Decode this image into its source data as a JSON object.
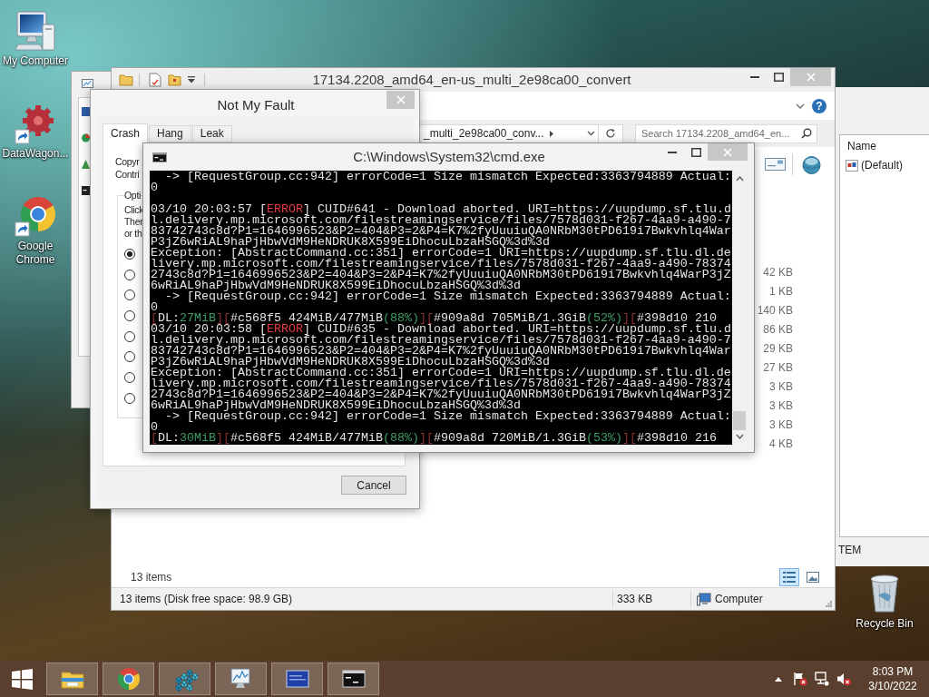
{
  "desktop_icons": [
    {
      "label": "My Computer",
      "kind": "computer",
      "shortcut": false
    },
    {
      "label": "DataWagon...",
      "kind": "gear",
      "shortcut": true
    },
    {
      "label": "Google Chrome",
      "kind": "browser",
      "shortcut": true
    }
  ],
  "recycle_bin": {
    "label": "Recycle Bin"
  },
  "registry_window": {
    "column": "Name",
    "values": [
      "(Default)"
    ],
    "status": "TEM"
  },
  "explorer": {
    "title": "17134.2208_amd64_en-us_multi_2e98ca00_convert",
    "help": "?",
    "address": "_multi_2e98ca00_conv...",
    "search": {
      "placeholder": "Search 17134.2208_amd64_en..."
    },
    "sizes": [
      "42 KB",
      "1 KB",
      "140 KB",
      "86 KB",
      "29 KB",
      "27 KB",
      "3 KB",
      "3 KB",
      "3 KB",
      "4 KB"
    ],
    "item_count": "13 items",
    "views": [
      {
        "kind": "details",
        "selected": true
      },
      {
        "kind": "thumbnails",
        "selected": false
      }
    ],
    "status_bar": {
      "summary": "13 items (Disk free space: 98.9 GB)",
      "size": "333 KB",
      "location": "Computer"
    }
  },
  "fault_dialog": {
    "title": "Not My Fault",
    "tabs": [
      {
        "label": "Crash",
        "selected": true
      },
      {
        "label": "Hang",
        "selected": false
      },
      {
        "label": "Leak",
        "selected": false
      }
    ],
    "info_lines": [
      "Copyr",
      "Contri"
    ],
    "group_label": "Opti",
    "description_lines": [
      "Click",
      "Ther",
      "or th"
    ],
    "options": [
      {
        "selected": true
      },
      {
        "selected": false
      },
      {
        "selected": false
      },
      {
        "selected": false
      },
      {
        "selected": false
      },
      {
        "selected": false
      },
      {
        "selected": false
      },
      {
        "selected": false
      }
    ],
    "cancel": "Cancel"
  },
  "console": {
    "title": "C:\\Windows\\System32\\cmd.exe",
    "blocks": [
      {
        "lines": [
          {
            "segments": [
              {
                "text": "  -> [RequestGroup.cc:942] errorCode=1 Size mismatch Expected:3363794889 Actual:",
                "kind": "plain"
              }
            ]
          },
          {
            "segments": [
              {
                "text": "0",
                "kind": "plain"
              }
            ]
          }
        ]
      },
      {
        "lines": [
          {
            "segments": [
              {
                "text": "03/10 20:03:57 [",
                "kind": "plain"
              },
              {
                "text": "ERROR",
                "kind": "error"
              },
              {
                "text": "] CUID#641 - Download aborted. URI=https://uupdump.sf.tlu.d",
                "kind": "plain"
              }
            ]
          },
          {
            "segments": [
              {
                "text": "l.delivery.mp.microsoft.com/filestreamingservice/files/7578d031-f267-4aa9-a490-7",
                "kind": "plain"
              }
            ]
          },
          {
            "segments": [
              {
                "text": "83742743c8d?P1=1646996523&P2=404&P3=2&P4=K7%2fyUuuiuQA0NRbM30tPD619i7Bwkvhlq4War",
                "kind": "plain"
              }
            ]
          },
          {
            "segments": [
              {
                "text": "P3jZ6wRiAL9haPjHbwVdM9HeNDRUK8X599EiDhocuLbzaHSGQ%3d%3d",
                "kind": "plain"
              }
            ]
          },
          {
            "segments": [
              {
                "text": "Exception: [AbstractCommand.cc:351] errorCode=1 URI=https://uupdump.sf.tlu.dl.de",
                "kind": "plain"
              }
            ]
          },
          {
            "segments": [
              {
                "text": "livery.mp.microsoft.com/filestreamingservice/files/7578d031-f267-4aa9-a490-78374",
                "kind": "plain"
              }
            ]
          },
          {
            "segments": [
              {
                "text": "2743c8d?P1=1646996523&P2=404&P3=2&P4=K7%2fyUuuiuQA0NRbM30tPD619i7Bwkvhlq4WarP3jZ",
                "kind": "plain"
              }
            ]
          },
          {
            "segments": [
              {
                "text": "6wRiAL9haPjHbwVdM9HeNDRUK8X599EiDhocuLbzaHSGQ%3d%3d",
                "kind": "plain"
              }
            ]
          },
          {
            "segments": [
              {
                "text": "  -> [RequestGroup.cc:942] errorCode=1 Size mismatch Expected:3363794889 Actual:",
                "kind": "plain"
              }
            ]
          },
          {
            "segments": [
              {
                "text": "0",
                "kind": "plain"
              }
            ]
          },
          {
            "segments": [
              {
                "text": "[",
                "kind": "bracket"
              },
              {
                "text": "DL:",
                "kind": "plain"
              },
              {
                "text": "27MiB",
                "kind": "value"
              },
              {
                "text": "][",
                "kind": "bracket"
              },
              {
                "text": "#c568f5 424MiB/477MiB",
                "kind": "plain"
              },
              {
                "text": "(88%)",
                "kind": "value"
              },
              {
                "text": "][",
                "kind": "bracket"
              },
              {
                "text": "#909a8d 705MiB/1.3GiB",
                "kind": "plain"
              },
              {
                "text": "(52%)",
                "kind": "value"
              },
              {
                "text": "][",
                "kind": "bracket"
              },
              {
                "text": "#398d10 210",
                "kind": "plain"
              }
            ]
          },
          {
            "segments": [
              {
                "text": "03/10 20:03:58 [",
                "kind": "plain"
              },
              {
                "text": "ERROR",
                "kind": "error"
              },
              {
                "text": "] CUID#635 - Download aborted. URI=https://uupdump.sf.tlu.d",
                "kind": "plain"
              }
            ]
          },
          {
            "segments": [
              {
                "text": "l.delivery.mp.microsoft.com/filestreamingservice/files/7578d031-f267-4aa9-a490-7",
                "kind": "plain"
              }
            ]
          },
          {
            "segments": [
              {
                "text": "83742743c8d?P1=1646996523&P2=404&P3=2&P4=K7%2fyUuuiuQA0NRbM30tPD619i7Bwkvhlq4War",
                "kind": "plain"
              }
            ]
          },
          {
            "segments": [
              {
                "text": "P3jZ6wRiAL9haPjHbwVdM9HeNDRUK8X599EiDhocuLbzaHSGQ%3d%3d",
                "kind": "plain"
              }
            ]
          },
          {
            "segments": [
              {
                "text": "Exception: [AbstractCommand.cc:351] errorCode=1 URI=https://uupdump.sf.tlu.dl.de",
                "kind": "plain"
              }
            ]
          },
          {
            "segments": [
              {
                "text": "livery.mp.microsoft.com/filestreamingservice/files/7578d031-f267-4aa9-a490-78374",
                "kind": "plain"
              }
            ]
          },
          {
            "segments": [
              {
                "text": "2743c8d?P1=1646996523&P2=404&P3=2&P4=K7%2fyUuuiuQA0NRbM30tPD619i7Bwkvhlq4WarP3jZ",
                "kind": "plain"
              }
            ]
          },
          {
            "segments": [
              {
                "text": "6wRiAL9haPjHbwVdM9HeNDRUK8X599EiDhocuLbzaHSGQ%3d%3d",
                "kind": "plain"
              }
            ]
          },
          {
            "segments": [
              {
                "text": "  -> [RequestGroup.cc:942] errorCode=1 Size mismatch Expected:3363794889 Actual:",
                "kind": "plain"
              }
            ]
          },
          {
            "segments": [
              {
                "text": "0",
                "kind": "plain"
              }
            ]
          },
          {
            "segments": [
              {
                "text": "[",
                "kind": "bracket"
              },
              {
                "text": "DL:",
                "kind": "plain"
              },
              {
                "text": "30MiB",
                "kind": "value"
              },
              {
                "text": "][",
                "kind": "bracket"
              },
              {
                "text": "#c568f5 424MiB/477MiB",
                "kind": "plain"
              },
              {
                "text": "(88%)",
                "kind": "value"
              },
              {
                "text": "][",
                "kind": "bracket"
              },
              {
                "text": "#909a8d 720MiB/1.3GiB",
                "kind": "plain"
              },
              {
                "text": "(53%)",
                "kind": "value"
              },
              {
                "text": "][",
                "kind": "bracket"
              },
              {
                "text": "#398d10 216",
                "kind": "plain"
              }
            ]
          }
        ]
      }
    ]
  },
  "taskbar": {
    "apps": [
      {
        "kind": "explorer"
      },
      {
        "kind": "browser"
      },
      {
        "kind": "registry"
      },
      {
        "kind": "monitor"
      },
      {
        "kind": "screen"
      },
      {
        "kind": "console"
      }
    ],
    "muted": true,
    "clock": {
      "time": "8:03 PM",
      "date": "3/10/2022"
    }
  }
}
